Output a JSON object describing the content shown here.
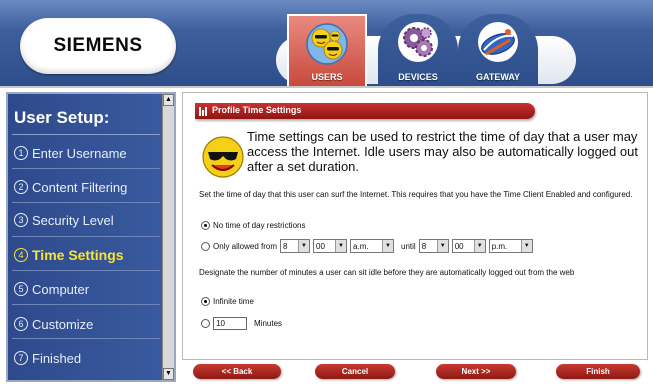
{
  "brand": {
    "logo_text": "SIEMENS"
  },
  "nav": {
    "tabs": [
      {
        "label": "USERS",
        "icon": "users-smileys-icon",
        "active": true
      },
      {
        "label": "DEVICES",
        "icon": "devices-gears-icon",
        "active": false
      },
      {
        "label": "GATEWAY",
        "icon": "gateway-router-icon",
        "active": false
      }
    ]
  },
  "sidebar": {
    "title": "User Setup:",
    "steps": [
      {
        "num": "1",
        "label": "Enter Username"
      },
      {
        "num": "2",
        "label": "Content Filtering"
      },
      {
        "num": "3",
        "label": "Security Level"
      },
      {
        "num": "4",
        "label": "Time Settings",
        "active": true
      },
      {
        "num": "5",
        "label": "Computer"
      },
      {
        "num": "6",
        "label": "Customize"
      },
      {
        "num": "7",
        "label": "Finished"
      }
    ]
  },
  "main": {
    "section_title": "Profile Time Settings",
    "intro": "Time settings can be used to restrict the time of day that a user may access the Internet. Idle users may also be automatically logged out after a set duration.",
    "time_desc": "Set the time of day that this user can surf the Internet. This requires that you have the Time Client Enabled and configured.",
    "opt_none": "No time of day restrictions",
    "opt_only": "Only allowed from",
    "until": "until",
    "from_hour": "8",
    "from_min": "00",
    "from_ampm": "a.m.",
    "to_hour": "8",
    "to_min": "00",
    "to_ampm": "p.m.",
    "idle_desc": "Designate the number of minutes a user can sit idle before they are automatically logged out from the web",
    "opt_infinite": "Infinite time",
    "minutes_value": "10",
    "minutes_label": "Minutes"
  },
  "buttons": {
    "back": "<< Back",
    "cancel": "Cancel",
    "next": "Next >>",
    "finish": "Finish"
  },
  "colors": {
    "header_blue": "#3d5f9c",
    "accent_red": "#b42a24",
    "active_step_yellow": "#f7e43a"
  }
}
